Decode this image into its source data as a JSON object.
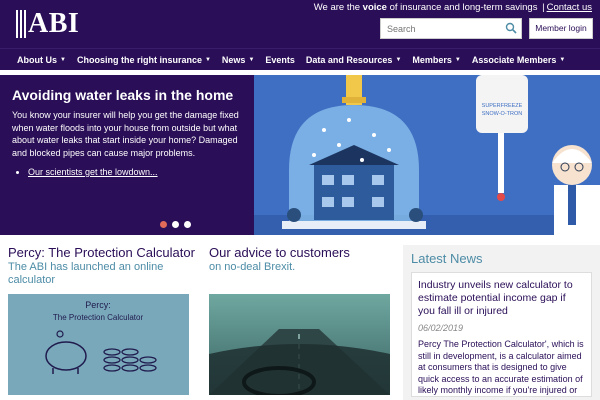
{
  "header": {
    "logo_text": "ABI",
    "tagline_prefix": "We are the ",
    "tagline_bold": "voice",
    "tagline_suffix": " of insurance and long-term savings",
    "tagline_sep": "|",
    "contact_link": "Contact us",
    "search_placeholder": "Search",
    "member_login": "Member login"
  },
  "nav": {
    "items": [
      {
        "label": "About Us",
        "dropdown": true
      },
      {
        "label": "Choosing the right insurance",
        "dropdown": true
      },
      {
        "label": "News",
        "dropdown": true
      },
      {
        "label": "Events",
        "dropdown": false
      },
      {
        "label": "Data and Resources",
        "dropdown": true
      },
      {
        "label": "Members",
        "dropdown": true
      },
      {
        "label": "Associate Members",
        "dropdown": true
      }
    ]
  },
  "hero": {
    "title": "Avoiding water leaks in the home",
    "body": "You know your insurer will help you get the damage fixed when water floods into your house from outside but what about water leaks that start inside your home? Damaged and blocked pipes can cause major problems.",
    "link": "Our scientists get the lowdown...",
    "device_label_1": "SUPERFREEZE",
    "device_label_2": "SNOW-O-TRON",
    "slides": 3,
    "active_slide": 1
  },
  "columns": {
    "percy": {
      "title": "Percy: The Protection Calculator",
      "subtitle": "The ABI has launched an online calculator",
      "image_title_1": "Percy:",
      "image_title_2": "The Protection Calculator"
    },
    "advice": {
      "title": "Our advice to customers",
      "subtitle": "on no-deal Brexit."
    },
    "news": {
      "title": "Latest News",
      "headline": "Industry unveils new calculator to estimate potential income gap if you fall ill or injured",
      "date": "06/02/2019",
      "body": "Percy The Protection Calculator', which is still in development, is a calculator aimed at consumers that is designed to give quick access to an accurate estimation of likely monthly income if you're injured or fall ill. This is done by tapping into the Government's benefit"
    }
  },
  "colors": {
    "brand_purple": "#2a0e57",
    "accent_teal": "#4d8ca6",
    "dot_active": "#e26a58"
  }
}
